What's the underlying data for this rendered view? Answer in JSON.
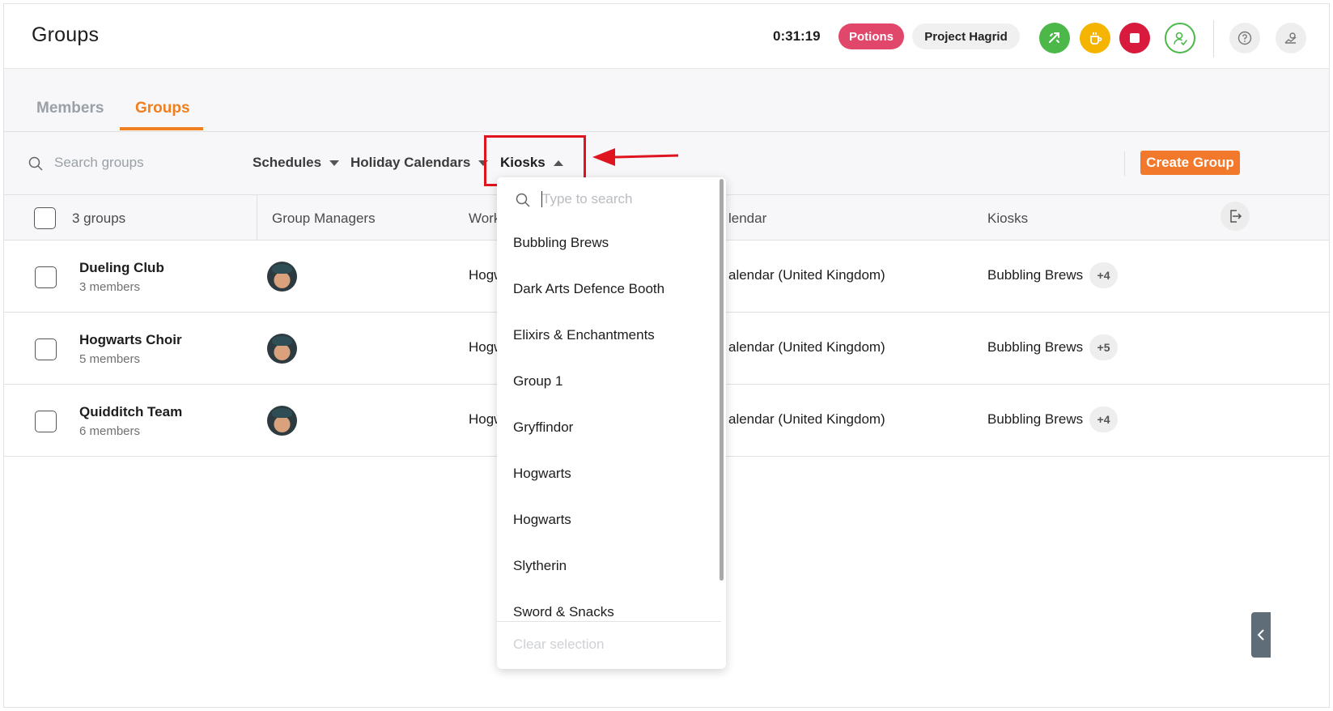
{
  "header": {
    "title": "Groups",
    "timer": "0:31:19",
    "activity_label": "Potions",
    "project_label": "Project Hagrid",
    "colors": {
      "accent": "#f07f1f",
      "potions": "#e0476a",
      "green": "#4cb84a",
      "yellow": "#f4b400",
      "red": "#d81b3c"
    },
    "icons": [
      "switch-task-icon",
      "break-icon",
      "stop-icon",
      "user-check-icon",
      "help-icon",
      "settings-icon"
    ]
  },
  "tabs": [
    {
      "label": "Members",
      "active": false
    },
    {
      "label": "Groups",
      "active": true
    }
  ],
  "toolbar": {
    "search_placeholder": "Search groups",
    "filters": {
      "schedules": "Schedules",
      "holiday_calendars": "Holiday Calendars",
      "kiosks": "Kiosks"
    },
    "create_label": "Create Group"
  },
  "table": {
    "count_label": "3 groups",
    "headers": {
      "managers": "Group Managers",
      "work": "Work",
      "holiday": "lendar",
      "kiosks": "Kiosks"
    },
    "rows": [
      {
        "name": "Dueling Club",
        "members": "3 members",
        "work": "Hogw",
        "holiday": "alendar (United Kingdom)",
        "kiosk": "Bubbling Brews",
        "more": "+4"
      },
      {
        "name": "Hogwarts Choir",
        "members": "5 members",
        "work": "Hogw",
        "holiday": "alendar (United Kingdom)",
        "kiosk": "Bubbling Brews",
        "more": "+5"
      },
      {
        "name": "Quidditch Team",
        "members": "6 members",
        "work": "Hogw",
        "holiday": "alendar (United Kingdom)",
        "kiosk": "Bubbling Brews",
        "more": "+4"
      }
    ]
  },
  "dropdown": {
    "search_placeholder": "Type to search",
    "items": [
      "Bubbling Brews",
      "Dark Arts Defence Booth",
      "Elixirs & Enchantments",
      "Group 1",
      "Gryffindor",
      "Hogwarts",
      "Hogwarts",
      "Slytherin",
      "Sword & Snacks"
    ],
    "clear_label": "Clear selection"
  }
}
